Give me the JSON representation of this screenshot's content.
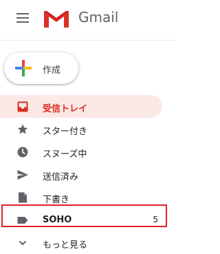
{
  "header": {
    "menu_icon": "hamburger-menu-icon",
    "logo_text": "Gmail"
  },
  "compose": {
    "label": "作成",
    "icon": "plus-icon"
  },
  "nav": {
    "items": [
      {
        "label": "受信トレイ",
        "icon": "inbox-icon",
        "active": true
      },
      {
        "label": "スター付き",
        "icon": "star-icon"
      },
      {
        "label": "スヌーズ中",
        "icon": "clock-icon"
      },
      {
        "label": "送信済み",
        "icon": "send-icon"
      },
      {
        "label": "下書き",
        "icon": "draft-icon"
      },
      {
        "label": "SOHO",
        "icon": "label-icon",
        "count": "5"
      },
      {
        "label": "もっと見る",
        "icon": "chevron-down-icon"
      }
    ]
  },
  "colors": {
    "accent": "#d93025",
    "active_bg": "#fce8e6",
    "highlight_border": "#e0202a"
  }
}
